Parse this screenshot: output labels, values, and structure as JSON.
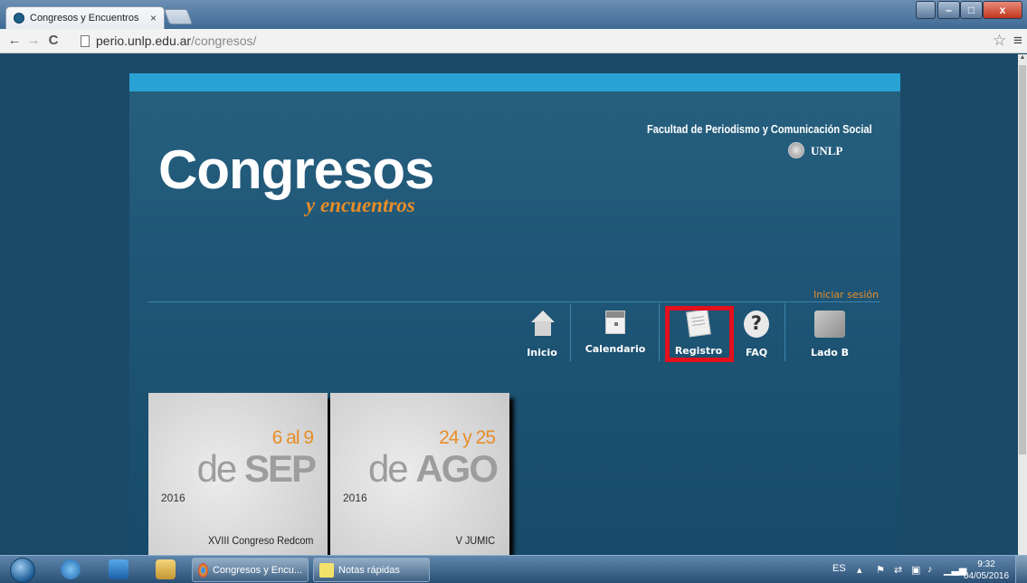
{
  "browser": {
    "tab_title": "Congresos y Encuentros",
    "tab_close": "×",
    "url_host": "perio.unlp.edu.ar",
    "url_path": "/congresos/",
    "back": "←",
    "forward": "→",
    "reload": "C",
    "star": "☆",
    "menu": "≡",
    "window_min": "–",
    "window_max": "□",
    "window_close": "x"
  },
  "site": {
    "logo": "Congresos",
    "sublogo": "y encuentros",
    "faculty": "Facultad de Periodismo y Comunicación Social",
    "university": "UNLP",
    "login_link": "Iniciar sesión",
    "accent_color": "#e88d28",
    "nav": [
      {
        "label": "Inicio",
        "icon": "home-icon"
      },
      {
        "label": "Calendario",
        "icon": "calendar-icon"
      },
      {
        "label": "Registro",
        "icon": "registration-form-icon",
        "highlighted": true
      },
      {
        "label": "FAQ",
        "icon": "question-icon"
      },
      {
        "label": "Lado B",
        "icon": "lado-b-icon"
      }
    ],
    "faq_glyph": "?",
    "events": [
      {
        "range": "6 al 9",
        "month_prefix": "de",
        "month": "SEP",
        "year": "2016",
        "name": "XVIII Congreso Redcom"
      },
      {
        "range": "24 y 25",
        "month_prefix": "de",
        "month": "AGO",
        "year": "2016",
        "name": "V JUMIC"
      }
    ]
  },
  "taskbar": {
    "tasks": [
      {
        "label": "Congresos y Encu...",
        "icon": "chrome-icon"
      },
      {
        "label": "Notas rápidas",
        "icon": "sticky-notes-icon"
      }
    ],
    "language": "ES",
    "time": "9:32",
    "date": "04/05/2016"
  }
}
